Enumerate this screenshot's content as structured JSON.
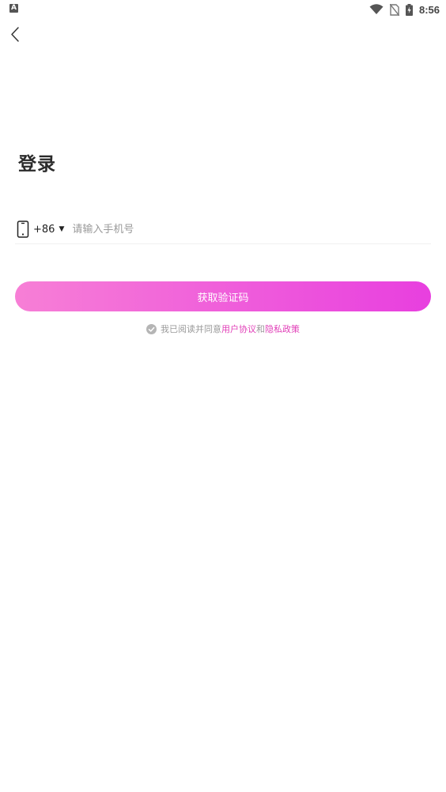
{
  "status_bar": {
    "time": "8:56",
    "left_icon": "A",
    "icons": [
      "wifi-icon",
      "no-sim-icon",
      "battery-charging-icon"
    ]
  },
  "header": {
    "back_icon": "chevron-left-icon"
  },
  "title": "登录",
  "phone": {
    "icon": "phone-icon",
    "country_code": "+86",
    "caret": "▼",
    "placeholder": "请输入手机号",
    "value": ""
  },
  "cta": {
    "label": "获取验证码",
    "gradient_start": "#f77fd6",
    "gradient_end": "#e83fdf"
  },
  "agreement": {
    "prefix": "我已阅读并同意",
    "user_agreement": "用户协议",
    "conjunction": "和",
    "privacy_policy": "隐私政策",
    "link_color": "#e13fb8",
    "checked": true
  }
}
